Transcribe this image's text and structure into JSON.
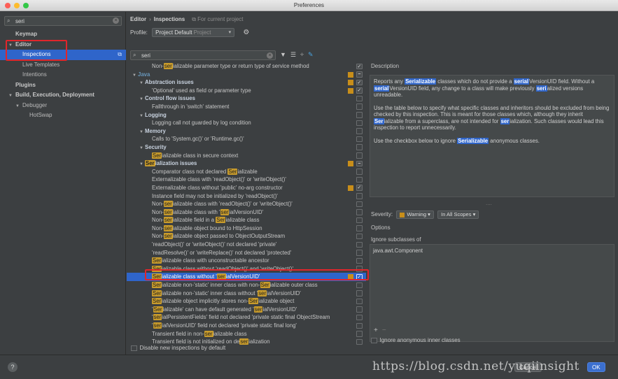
{
  "window": {
    "title": "Preferences"
  },
  "sidebar": {
    "search_value": "seri",
    "items": [
      {
        "label": "Keymap",
        "level": 0,
        "bold": true,
        "expanded": null,
        "selected": false
      },
      {
        "label": "Editor",
        "level": 0,
        "bold": true,
        "expanded": true,
        "selected": false
      },
      {
        "label": "Inspections",
        "level": 1,
        "bold": false,
        "expanded": null,
        "selected": true
      },
      {
        "label": "Live Templates",
        "level": 1,
        "bold": false,
        "expanded": null,
        "selected": false
      },
      {
        "label": "Intentions",
        "level": 1,
        "bold": false,
        "expanded": null,
        "selected": false
      },
      {
        "label": "Plugins",
        "level": 0,
        "bold": true,
        "expanded": null,
        "selected": false
      },
      {
        "label": "Build, Execution, Deployment",
        "level": 0,
        "bold": true,
        "expanded": true,
        "selected": false
      },
      {
        "label": "Debugger",
        "level": 1,
        "bold": false,
        "expanded": true,
        "selected": false
      },
      {
        "label": "HotSwap",
        "level": 2,
        "bold": false,
        "expanded": null,
        "selected": false
      }
    ]
  },
  "header": {
    "breadcrumb_root": "Editor",
    "breadcrumb_separator": "›",
    "breadcrumb_page": "Inspections",
    "breadcrumb_note": "For current project",
    "profile_label": "Profile:",
    "profile_value": "Project Default",
    "profile_sub": "Project"
  },
  "inspections": {
    "search_value": "seri",
    "rows": [
      {
        "level": 2,
        "parts": [
          [
            "Non-",
            false
          ],
          [
            "ser",
            true
          ],
          [
            "ializable parameter type or return type of service method",
            false
          ]
        ],
        "sev": false,
        "check": "checked"
      },
      {
        "level": 0,
        "cat": true,
        "java": true,
        "expanded": true,
        "parts": [
          [
            "Java",
            false
          ]
        ],
        "sev": true,
        "check": "partial"
      },
      {
        "level": 1,
        "cat": true,
        "expanded": true,
        "parts": [
          [
            "Abstraction issues",
            false
          ]
        ],
        "sev": true,
        "check": "checked"
      },
      {
        "level": 2,
        "parts": [
          [
            "'Optional' used as field or parameter type",
            false
          ]
        ],
        "sev": true,
        "check": "checked"
      },
      {
        "level": 1,
        "cat": true,
        "expanded": true,
        "parts": [
          [
            "Control flow issues",
            false
          ]
        ],
        "sev": false,
        "check": "none"
      },
      {
        "level": 2,
        "parts": [
          [
            "Fallthrough in 'switch' statement",
            false
          ]
        ],
        "sev": false,
        "check": "none"
      },
      {
        "level": 1,
        "cat": true,
        "expanded": true,
        "parts": [
          [
            "Logging",
            false
          ]
        ],
        "sev": false,
        "check": "none"
      },
      {
        "level": 2,
        "parts": [
          [
            "Logging call not guarded by log condition",
            false
          ]
        ],
        "sev": false,
        "check": "none"
      },
      {
        "level": 1,
        "cat": true,
        "expanded": true,
        "parts": [
          [
            "Memory",
            false
          ]
        ],
        "sev": false,
        "check": "none"
      },
      {
        "level": 2,
        "parts": [
          [
            "Calls to 'System.gc()' or 'Runtime.gc()'",
            false
          ]
        ],
        "sev": false,
        "check": "none"
      },
      {
        "level": 1,
        "cat": true,
        "expanded": true,
        "parts": [
          [
            "Security",
            false
          ]
        ],
        "sev": false,
        "check": "none"
      },
      {
        "level": 2,
        "parts": [
          [
            "Ser",
            true
          ],
          [
            "ializable class in secure context",
            false
          ]
        ],
        "sev": false,
        "check": "none"
      },
      {
        "level": 1,
        "cat": true,
        "expanded": true,
        "parts": [
          [
            "Ser",
            true
          ],
          [
            "ialization issues",
            false
          ]
        ],
        "sev": true,
        "check": "partial"
      },
      {
        "level": 2,
        "parts": [
          [
            "Comparator class not declared ",
            false
          ],
          [
            "Ser",
            true
          ],
          [
            "ializable",
            false
          ]
        ],
        "sev": false,
        "check": "none"
      },
      {
        "level": 2,
        "parts": [
          [
            "Externalizable class with 'readObject()' or 'writeObject()'",
            false
          ]
        ],
        "sev": false,
        "check": "none"
      },
      {
        "level": 2,
        "parts": [
          [
            "Externalizable class without 'public' no-arg constructor",
            false
          ]
        ],
        "sev": true,
        "check": "checked"
      },
      {
        "level": 2,
        "parts": [
          [
            "Instance field may not be initialized by 'readObject()'",
            false
          ]
        ],
        "sev": false,
        "check": "none"
      },
      {
        "level": 2,
        "parts": [
          [
            "Non-",
            false
          ],
          [
            "ser",
            true
          ],
          [
            "ializable class with 'readObject()' or 'writeObject()'",
            false
          ]
        ],
        "sev": false,
        "check": "none"
      },
      {
        "level": 2,
        "parts": [
          [
            "Non-",
            false
          ],
          [
            "ser",
            true
          ],
          [
            "ializable class with '",
            false
          ],
          [
            "ser",
            true
          ],
          [
            "ialVersionUID'",
            false
          ]
        ],
        "sev": false,
        "check": "none"
      },
      {
        "level": 2,
        "parts": [
          [
            "Non-",
            false
          ],
          [
            "ser",
            true
          ],
          [
            "ializable field in a ",
            false
          ],
          [
            "Ser",
            true
          ],
          [
            "ializable class",
            false
          ]
        ],
        "sev": false,
        "check": "none"
      },
      {
        "level": 2,
        "parts": [
          [
            "Non-",
            false
          ],
          [
            "ser",
            true
          ],
          [
            "ializable object bound to HttpSession",
            false
          ]
        ],
        "sev": false,
        "check": "none"
      },
      {
        "level": 2,
        "parts": [
          [
            "Non-",
            false
          ],
          [
            "ser",
            true
          ],
          [
            "ializable object passed to ObjectOutputStream",
            false
          ]
        ],
        "sev": false,
        "check": "none"
      },
      {
        "level": 2,
        "parts": [
          [
            "'readObject()' or 'writeObject()' not declared 'private'",
            false
          ]
        ],
        "sev": false,
        "check": "none"
      },
      {
        "level": 2,
        "parts": [
          [
            "'readResolve()' or 'writeReplace()' not declared 'protected'",
            false
          ]
        ],
        "sev": false,
        "check": "none"
      },
      {
        "level": 2,
        "parts": [
          [
            "Ser",
            true
          ],
          [
            "ializable class with unconstructable ancestor",
            false
          ]
        ],
        "sev": false,
        "check": "none"
      },
      {
        "level": 2,
        "parts": [
          [
            "Ser",
            true
          ],
          [
            "ializable class without 'readObject()' and 'writeObject()'",
            false
          ]
        ],
        "sev": false,
        "check": "none"
      },
      {
        "level": 2,
        "selected": true,
        "parts": [
          [
            "Ser",
            true
          ],
          [
            "ializable class without '",
            false
          ],
          [
            "ser",
            true
          ],
          [
            "ialVersionUID'",
            false
          ]
        ],
        "sev": true,
        "check": "checked"
      },
      {
        "level": 2,
        "parts": [
          [
            "Ser",
            true
          ],
          [
            "ializable non-'static' inner class with non-",
            false
          ],
          [
            "Ser",
            true
          ],
          [
            "ializable outer class",
            false
          ]
        ],
        "sev": false,
        "check": "none"
      },
      {
        "level": 2,
        "parts": [
          [
            "Ser",
            true
          ],
          [
            "ializable non-'static' inner class without '",
            false
          ],
          [
            "ser",
            true
          ],
          [
            "ialVersionUID'",
            false
          ]
        ],
        "sev": false,
        "check": "none"
      },
      {
        "level": 2,
        "parts": [
          [
            "Ser",
            true
          ],
          [
            "ializable object implicitly stores non-",
            false
          ],
          [
            "Ser",
            true
          ],
          [
            "ializable object",
            false
          ]
        ],
        "sev": false,
        "check": "none"
      },
      {
        "level": 2,
        "parts": [
          [
            "'",
            false
          ],
          [
            "Ser",
            true
          ],
          [
            "ializable' can have default generated '",
            false
          ],
          [
            "ser",
            true
          ],
          [
            "ialVersionUID'",
            false
          ]
        ],
        "sev": false,
        "check": "none"
      },
      {
        "level": 2,
        "parts": [
          [
            "'",
            false
          ],
          [
            "ser",
            true
          ],
          [
            "ialPersistentFields' field not declared 'private static final ObjectStream",
            false
          ]
        ],
        "sev": false,
        "check": "none"
      },
      {
        "level": 2,
        "parts": [
          [
            "'",
            false
          ],
          [
            "ser",
            true
          ],
          [
            "ialVersionUID' field not declared 'private static final long'",
            false
          ]
        ],
        "sev": false,
        "check": "none"
      },
      {
        "level": 2,
        "parts": [
          [
            "Transient field in non-",
            false
          ],
          [
            "ser",
            true
          ],
          [
            "ializable class",
            false
          ]
        ],
        "sev": false,
        "check": "none"
      },
      {
        "level": 2,
        "parts": [
          [
            "Transient field is not initialized on de",
            false
          ],
          [
            "ser",
            true
          ],
          [
            "ialization",
            false
          ]
        ],
        "sev": false,
        "check": "none"
      }
    ],
    "disable_new_label": "Disable new inspections by default"
  },
  "description": {
    "title": "Description",
    "p1": [
      [
        "Reports any ",
        false
      ],
      [
        "Serializable",
        true
      ],
      [
        " classes which do not provide a ",
        false
      ],
      [
        "serial",
        true
      ],
      [
        "VersionUID",
        false
      ],
      [
        " field. Without a ",
        false
      ],
      [
        "serial",
        true
      ],
      [
        "VersionUID field, any change to a class will make previously ",
        false
      ],
      [
        "seri",
        true
      ],
      [
        "alized versions unreadable.",
        false
      ]
    ],
    "p2": [
      [
        "Use the table below to specify what specific classes and inheritors should be excluded from being checked by this inspection. This is meant for those classes which, although they inherit ",
        false
      ],
      [
        "Ser",
        true
      ],
      [
        "ializable from a superclass, are not intended for ",
        false
      ],
      [
        "ser",
        true
      ],
      [
        "ialization. Such classes would lead this inspection to report unnecessarily.",
        false
      ]
    ],
    "p3": [
      [
        "Use the checkbox below to ignore ",
        false
      ],
      [
        "Serializable",
        true
      ],
      [
        " anonymous classes.",
        false
      ]
    ],
    "dots": "....",
    "severity_label": "Severity:",
    "severity_value": "Warning",
    "scope_value": "In All Scopes",
    "options_label": "Options",
    "ignore_label": "Ignore subclasses of",
    "ignore_items": [
      "java.awt.Component"
    ],
    "ignore_anon_label": "Ignore anonymous inner classes"
  },
  "footer": {
    "help": "?",
    "watermark": "https://blog.csdn.net/yuqiinsight",
    "cancel_label": "Cancel",
    "ok_label": "OK"
  },
  "colors": {
    "accent": "#2f65ca",
    "highlight": "#c99c2c",
    "warning": "#c88e1a",
    "annotation_red": "#e0262b"
  }
}
